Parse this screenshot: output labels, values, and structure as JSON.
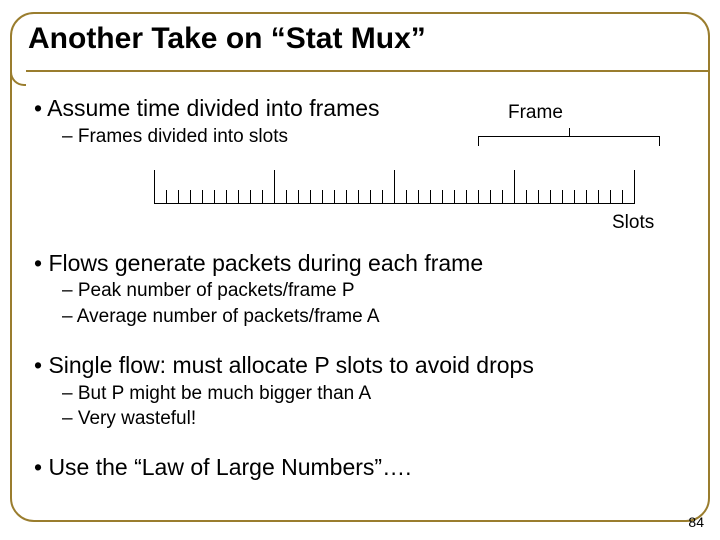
{
  "title": "Another Take on “Stat Mux”",
  "labels": {
    "frame": "Frame",
    "slots": "Slots"
  },
  "blocks": [
    {
      "bullet": "• Assume time divided into frames",
      "subs": [
        "– Frames divided into slots"
      ]
    },
    {
      "bullet": "• Flows generate packets during each frame",
      "subs": [
        "– Peak number of packets/frame P",
        "– Average number of packets/frame A"
      ]
    },
    {
      "bullet": "• Single flow: must allocate P slots to avoid drops",
      "subs": [
        "– But P might be much bigger than A",
        "– Very wasteful!"
      ]
    },
    {
      "bullet": "• Use the “Law of Large Numbers”….",
      "subs": []
    }
  ],
  "page_number": "84",
  "chart_data": {
    "type": "table",
    "description": "Timeline showing frames subdivided into slots",
    "frames": 4,
    "slots_per_frame": 10,
    "frame_boundary_positions": [
      0,
      120,
      240,
      360,
      480
    ],
    "bracket_frame_index": 3
  }
}
